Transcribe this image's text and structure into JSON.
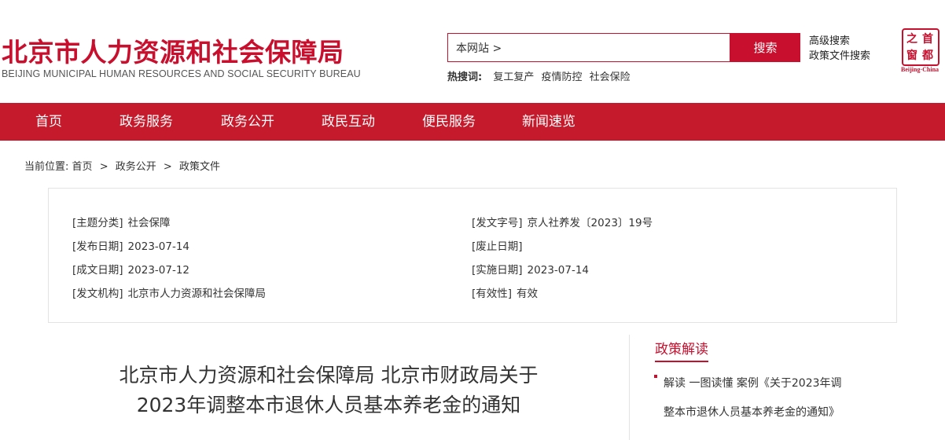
{
  "header": {
    "title": "北京市人力资源和社会保障局",
    "subtitle": "BEIJING MUNICIPAL HUMAN RESOURCES AND SOCIAL SECURITY BUREAU",
    "search": {
      "value": "本网站 >",
      "button_label": "搜索"
    },
    "advanced_search": "高级搜索",
    "policy_search": "政策文件搜索",
    "hot": {
      "label": "热搜词:",
      "items": [
        "复工复产",
        "疫情防控",
        "社会保险"
      ]
    },
    "logo": {
      "chars": [
        "首",
        "都",
        "之",
        "窗"
      ],
      "caption": "Beijing·China"
    }
  },
  "nav": {
    "items": [
      "首页",
      "政务服务",
      "政务公开",
      "政民互动",
      "便民服务",
      "新闻速览"
    ]
  },
  "breadcrumb": {
    "label": "当前位置:",
    "items": [
      "首页",
      "政务公开",
      "政策文件"
    ],
    "separator": ">"
  },
  "meta": {
    "subject_key": "[主题分类]",
    "subject_val": "社会保障",
    "doc_no_key": "[发文字号]",
    "doc_no_val": "京人社养发〔2023〕19号",
    "publish_key": "[发布日期]",
    "publish_val": "2023-07-14",
    "abolish_key": "[废止日期]",
    "abolish_val": "",
    "written_key": "[成文日期]",
    "written_val": "2023-07-12",
    "effective_key": "[实施日期]",
    "effective_val": "2023-07-14",
    "issuer_key": "[发文机构]",
    "issuer_val": "北京市人力资源和社会保障局",
    "validity_key": "[有效性]",
    "validity_val": "有效"
  },
  "article": {
    "title_line1": "北京市人力资源和社会保障局 北京市财政局关于",
    "title_line2": "2023年调整本市退休人员基本养老金的通知"
  },
  "sidebar": {
    "heading": "政策解读",
    "item_line1": "解读 一图读懂 案例《关于2023年调",
    "item_line2": "整本市退休人员基本养老金的通知》"
  },
  "colors": {
    "brand_red": "#c8102e",
    "nav_red": "#c41a2b"
  }
}
